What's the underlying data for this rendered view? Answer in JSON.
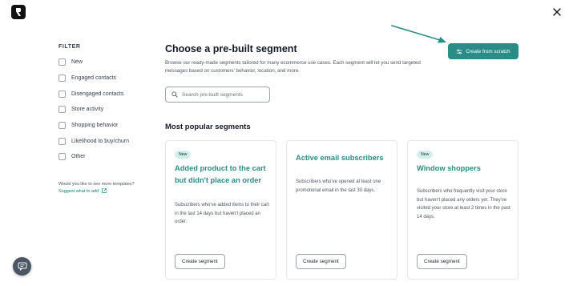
{
  "colors": {
    "accent": "#2a8c87",
    "badge_bg": "#d1f0ec",
    "arrow": "#2a8c87"
  },
  "icons": {
    "logo": "brand-logo-icon",
    "close": "close-icon",
    "search": "search-icon",
    "create": "sliders-icon",
    "external": "external-link-icon",
    "chat": "chat-icon"
  },
  "filter": {
    "title": "FILTER",
    "items": [
      "New",
      "Engaged contacts",
      "Disengaged contacts",
      "Store activity",
      "Shopping behavior",
      "Likelihood to buy/churn",
      "Other"
    ]
  },
  "more_templates": {
    "question": "Would you like to see more templates?",
    "link": "Suggest what to add"
  },
  "main": {
    "heading": "Choose a pre-built segment",
    "description": "Browse our ready-made segments tailored for many ecommerce use cases. Each segment will let you send targeted messages based on customers' behavior, location, and more.",
    "search_placeholder": "Search pre-built segments",
    "create_scratch_label": "Create from scratch",
    "section_title": "Most popular segments"
  },
  "cards": [
    {
      "badge": "New",
      "title": "Added product to the cart but didn't place an order",
      "text": "Subscribers who've added items to their cart in the last 14 days but haven't placed an order.",
      "button": "Create segment"
    },
    {
      "badge": "",
      "title": "Active email subscribers",
      "text": "Subscribers who've opened at least one promotional email in the last 30 days.",
      "button": "Create segment"
    },
    {
      "badge": "New",
      "title": "Window shoppers",
      "text": "Subscribers who frequently visit your store but haven't placed any orders yet. They've visited your store at least 2 times in the past 14 days.",
      "button": "Create segment"
    }
  ]
}
